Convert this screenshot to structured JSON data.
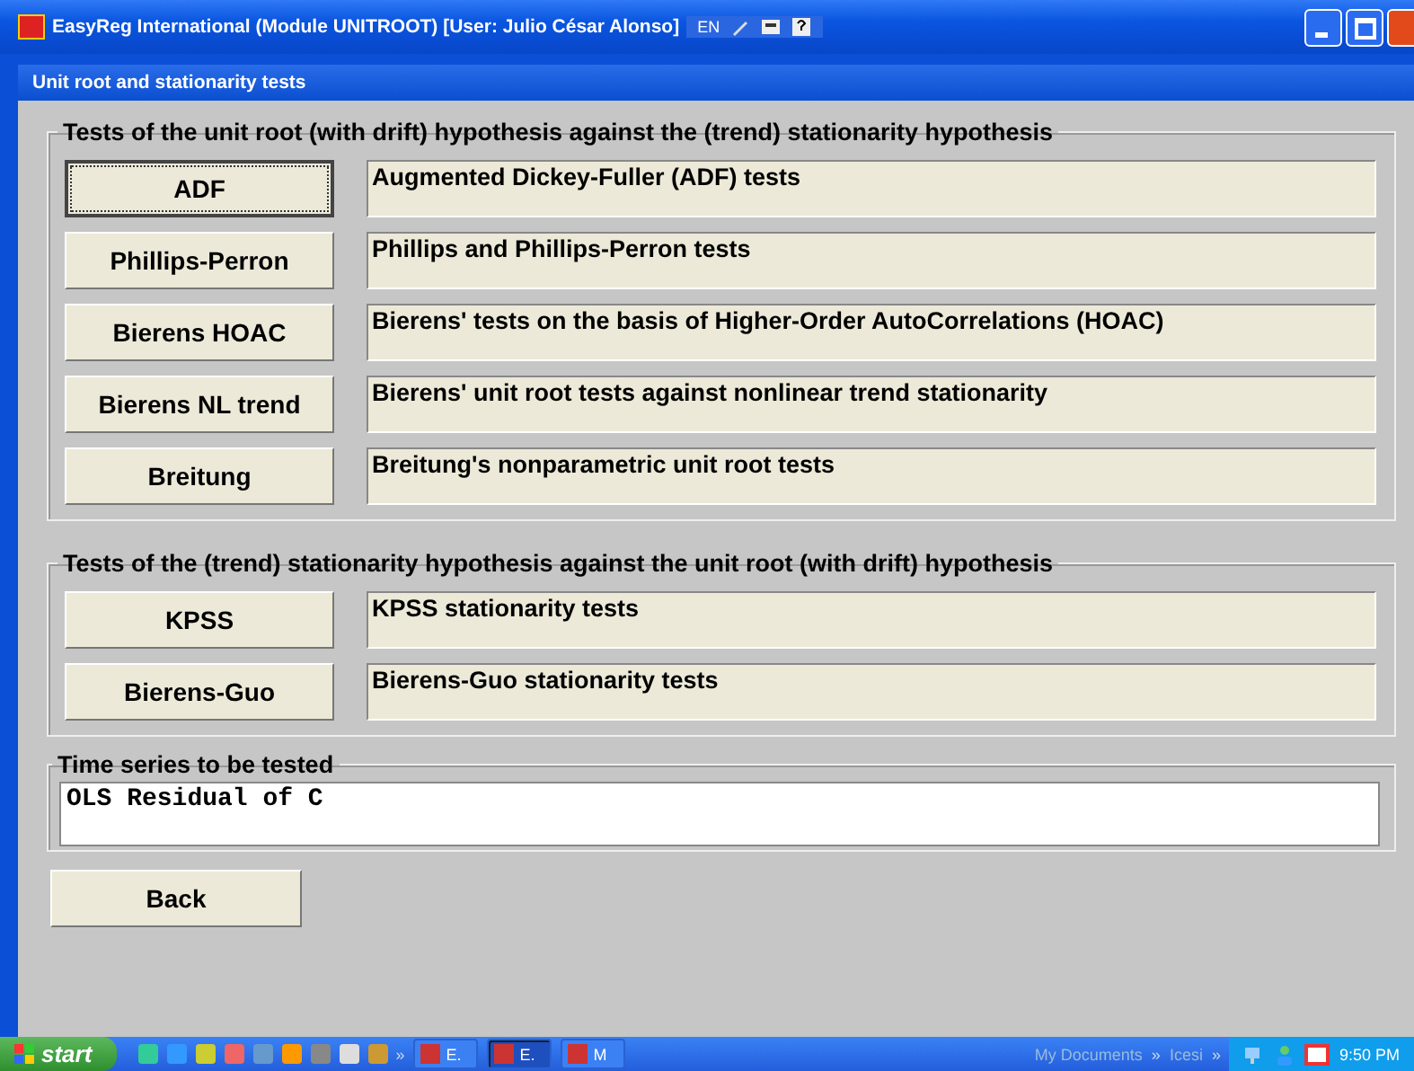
{
  "window": {
    "title": "EasyReg International (Module UNITROOT) [User: Julio César Alonso]",
    "language": "EN"
  },
  "dialog": {
    "title": "Unit root and stationarity tests"
  },
  "groups": [
    {
      "legend": "Tests of the unit root (with drift) hypothesis against the (trend) stationarity hypothesis",
      "tests": [
        {
          "label": "ADF",
          "description": "Augmented Dickey-Fuller (ADF) tests",
          "focused": true
        },
        {
          "label": "Phillips-Perron",
          "description": "Phillips and Phillips-Perron tests",
          "focused": false
        },
        {
          "label": "Bierens HOAC",
          "description": "Bierens' tests on the basis of Higher-Order AutoCorrelations (HOAC)",
          "focused": false
        },
        {
          "label": "Bierens NL trend",
          "description": "Bierens'  unit root tests against nonlinear trend stationarity",
          "focused": false
        },
        {
          "label": "Breitung",
          "description": "Breitung's nonparametric unit root tests",
          "focused": false
        }
      ]
    },
    {
      "legend": "Tests of the (trend) stationarity hypothesis against the unit root (with drift) hypothesis",
      "tests": [
        {
          "label": "KPSS",
          "description": "KPSS stationarity tests",
          "focused": false
        },
        {
          "label": "Bierens-Guo",
          "description": "Bierens-Guo stationarity tests",
          "focused": false
        }
      ]
    }
  ],
  "series": {
    "legend": "Time series to be tested",
    "value": "OLS Residual of C"
  },
  "back_button": "Back",
  "taskbar": {
    "start": "start",
    "more": "»",
    "tasks": [
      {
        "label": "E.",
        "selected": false
      },
      {
        "label": "E.",
        "selected": true
      },
      {
        "label": "M",
        "selected": false
      }
    ],
    "toolbars": [
      {
        "label": "My Documents",
        "more": "»"
      },
      {
        "label": "Icesi",
        "more": "»"
      }
    ],
    "clock": "9:50 PM"
  }
}
